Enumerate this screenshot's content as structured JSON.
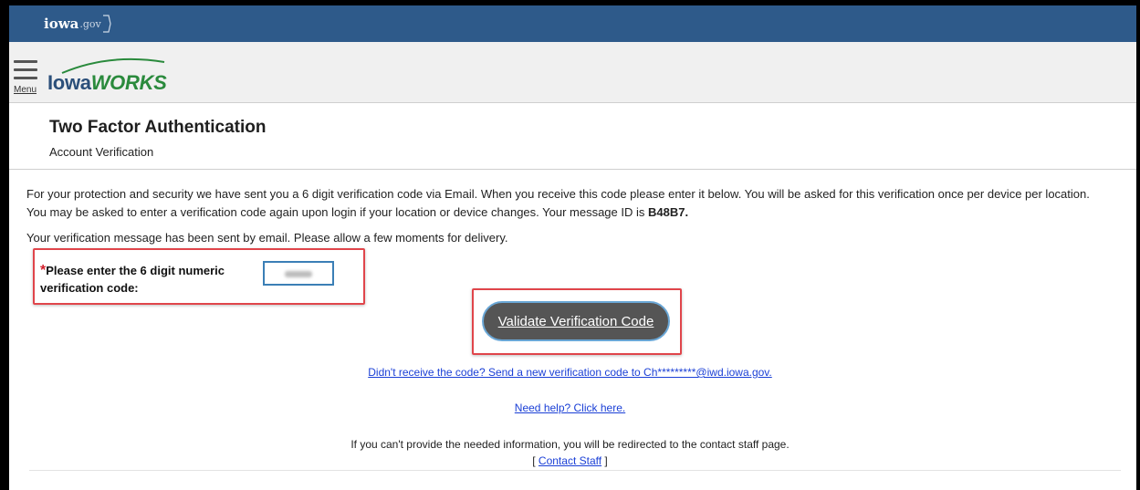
{
  "topbar": {
    "brand_word": "iowa",
    "brand_tld": ".gov"
  },
  "header": {
    "menu_label": "Menu",
    "logo_iowa": "Iowa",
    "logo_works": "WORKS"
  },
  "page": {
    "title": "Two Factor Authentication",
    "subtitle": "Account Verification"
  },
  "intro": {
    "line1": "For your protection and security we have sent you a 6 digit verification code via Email. When you receive this code please enter it below. You will be asked for this verification once per device per location.",
    "line2_prefix": "You may be asked to enter a verification code again upon login if your location or device changes. Your message ID is ",
    "message_id": "B48B7."
  },
  "sent_note": "Your verification message has been sent by email. Please allow a few moments for delivery.",
  "code_field": {
    "required_mark": "*",
    "label": "Please enter the 6 digit numeric verification code:"
  },
  "validate_button": "Validate Verification Code",
  "resend_link": "Didn't receive the code? Send a new verification code to Ch*********@iwd.iowa.gov.",
  "help_link": "Need help? Click here.",
  "cant_provide": "If you can't provide the needed information, you will be redirected to the contact staff page.",
  "contact": {
    "open": "[ ",
    "link": "Contact Staff",
    "close": " ]"
  },
  "colors": {
    "topbar": "#2e5a8a",
    "header_bg": "#f0f0f0",
    "button_bg": "#555555",
    "highlight": "#e0454b",
    "link": "#1a3fd6",
    "logo_blue": "#2b4f7a",
    "logo_green": "#2a8a3c"
  }
}
